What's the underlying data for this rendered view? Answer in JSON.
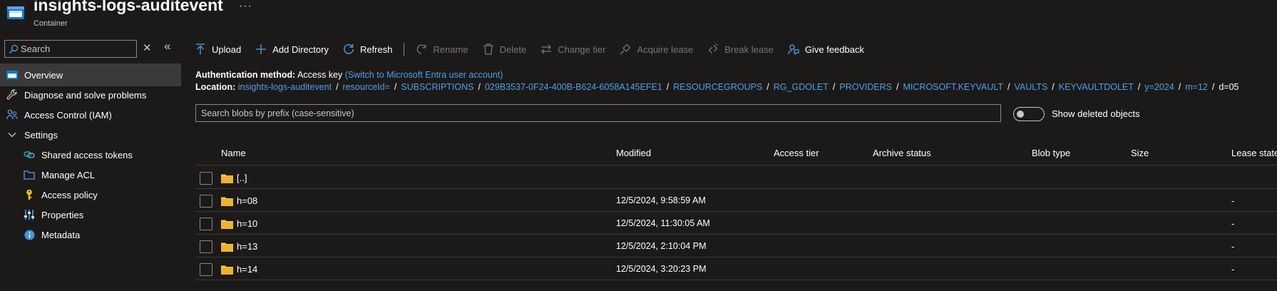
{
  "header": {
    "title": "insights-logs-auditevent",
    "subtitle": "Container",
    "more": "···"
  },
  "sidebar": {
    "search_placeholder": "Search",
    "clear": "✕",
    "collapse": "«",
    "items": [
      {
        "label": "Overview",
        "icon": "overview-icon",
        "active": true
      },
      {
        "label": "Diagnose and solve problems",
        "icon": "wrench-icon"
      },
      {
        "label": "Access Control (IAM)",
        "icon": "people-icon"
      },
      {
        "label": "Settings",
        "icon": "chevron-down-icon"
      },
      {
        "label": "Shared access tokens",
        "icon": "link-icon"
      },
      {
        "label": "Manage ACL",
        "icon": "folder-outline-icon"
      },
      {
        "label": "Access policy",
        "icon": "key-icon"
      },
      {
        "label": "Properties",
        "icon": "sliders-icon"
      },
      {
        "label": "Metadata",
        "icon": "info-icon"
      }
    ]
  },
  "toolbar": {
    "upload": "Upload",
    "add_directory": "Add Directory",
    "refresh": "Refresh",
    "rename": "Rename",
    "delete": "Delete",
    "change_tier": "Change tier",
    "acquire_lease": "Acquire lease",
    "break_lease": "Break lease",
    "give_feedback": "Give feedback"
  },
  "auth": {
    "label": "Authentication method:",
    "value": "Access key",
    "switch_link": "(Switch to Microsoft Entra user account)"
  },
  "location": {
    "label": "Location:",
    "segments": [
      "insights-logs-auditevent",
      "resourceId=",
      "SUBSCRIPTIONS",
      "029B3537-0F24-400B-B624-6058A145EFE1",
      "RESOURCEGROUPS",
      "RG_GDOLET",
      "PROVIDERS",
      "MICROSOFT.KEYVAULT",
      "VAULTS",
      "KEYVAULTDOLET",
      "y=2024",
      "m=12"
    ],
    "current": "d=05"
  },
  "blob_search": {
    "placeholder": "Search blobs by prefix (case-sensitive)"
  },
  "show_deleted": {
    "label": "Show deleted objects",
    "on": false
  },
  "table": {
    "columns": {
      "name": "Name",
      "modified": "Modified",
      "access_tier": "Access tier",
      "archive_status": "Archive status",
      "blob_type": "Blob type",
      "size": "Size",
      "lease_state": "Lease state"
    },
    "rows": [
      {
        "name": "[..]",
        "modified": "",
        "lease": ""
      },
      {
        "name": "h=08",
        "modified": "12/5/2024, 9:58:59 AM",
        "lease": "-"
      },
      {
        "name": "h=10",
        "modified": "12/5/2024, 11:30:05 AM",
        "lease": "-"
      },
      {
        "name": "h=13",
        "modified": "12/5/2024, 2:10:04 PM",
        "lease": "-"
      },
      {
        "name": "h=14",
        "modified": "12/5/2024, 3:20:23 PM",
        "lease": "-"
      }
    ]
  },
  "colors": {
    "background": "#1b1a19",
    "link": "#4f9fe8",
    "accent": "#0078d4",
    "folder": "#ffc83d"
  }
}
